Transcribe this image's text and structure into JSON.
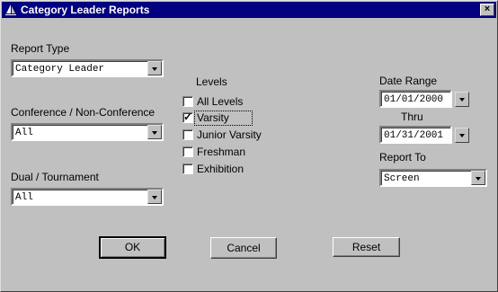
{
  "window": {
    "title": "Category Leader Reports",
    "close_glyph": "×"
  },
  "report_type": {
    "label": "Report Type",
    "value": "Category Leader"
  },
  "conference": {
    "label": "Conference / Non-Conference",
    "value": "All"
  },
  "dual": {
    "label": "Dual / Tournament",
    "value": "All"
  },
  "levels": {
    "label": "Levels",
    "items": [
      {
        "label": "All Levels",
        "checked": false
      },
      {
        "label": "Varsity",
        "checked": true
      },
      {
        "label": "Junior Varsity",
        "checked": false
      },
      {
        "label": "Freshman",
        "checked": false
      },
      {
        "label": "Exhibition",
        "checked": false
      }
    ],
    "check_glyph": "✓"
  },
  "date_range": {
    "label": "Date Range",
    "from": "01/01/2000",
    "thru_label": "Thru",
    "to": "01/31/2001"
  },
  "report_to": {
    "label": "Report To",
    "value": "Screen"
  },
  "buttons": {
    "ok": "OK",
    "cancel": "Cancel",
    "reset": "Reset"
  }
}
